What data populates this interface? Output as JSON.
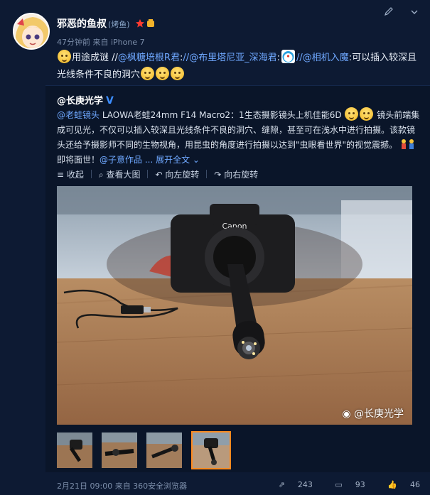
{
  "user": {
    "name": "邪恶的鱼叔",
    "tag": "(烤鱼)",
    "meta": "47分钟前 来自 iPhone 7"
  },
  "post": {
    "t1": "用途成谜 //",
    "m1": "@枫糖培根R君",
    "t2": ":",
    "m2": "//@布里塔尼亚_深海君",
    "t3": ":",
    "m3": "//@相机入魔",
    "t4": ":可以插入较深且光线条件不良的洞穴"
  },
  "repost": {
    "author": "@长庚光学",
    "link1": "@老蛙镜头",
    "text1": " LAOWA老蛙24mm F14 Macro2：1生态摄影镜头上机佳能6D",
    "text2": " 镜头前端集成可见光，不仅可以插入较深且光线条件不良的洞穴、缝隙，甚至可在浅水中进行拍摄。该款镜头还给予摄影师不同的生物视角，用昆虫的角度进行拍摄以达到\"虫眼看世界\"的视觉震撼。",
    "text3": " 即将面世！",
    "link2": "@子意作品",
    "more": " ... 展开全文 ⌄",
    "actions": {
      "collapse": "收起",
      "view_large": "查看大图",
      "rotate_left": "向左旋转",
      "rotate_right": "向右旋转"
    },
    "watermark": "@长庚光学"
  },
  "footer": {
    "time": "2月21日 09:00 来自 360安全浏览器",
    "reposts": "243",
    "comments": "93",
    "likes": "46"
  },
  "colors": {
    "background": "#0d1a33",
    "link": "#6fa8ff",
    "verified": "#3c8dff",
    "thumb_active": "#ff8a1f"
  }
}
